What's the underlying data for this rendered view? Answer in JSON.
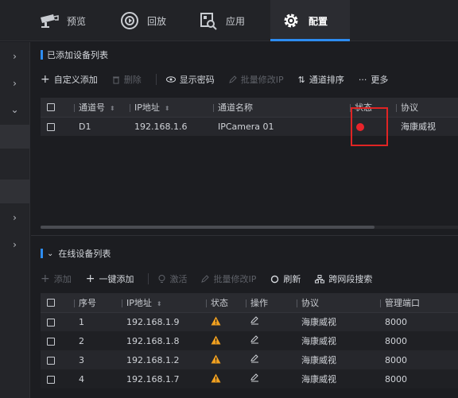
{
  "topnav": {
    "tabs": [
      {
        "label": "预览",
        "icon": "camera-icon"
      },
      {
        "label": "回放",
        "icon": "playback-icon"
      },
      {
        "label": "应用",
        "icon": "app-search-icon"
      },
      {
        "label": "配置",
        "icon": "gear-icon",
        "active": true
      }
    ]
  },
  "sidebar": {
    "items": [
      "›",
      "›",
      "⌄",
      "›",
      "›"
    ]
  },
  "added_section": {
    "title": "已添加设备列表",
    "toolbar": {
      "custom_add": "自定义添加",
      "delete": "删除",
      "show_password": "显示密码",
      "batch_ip": "批量修改IP",
      "channel_sort": "通道排序",
      "more": "更多"
    },
    "table": {
      "headers": [
        "通道号",
        "IP地址",
        "通道名称",
        "状态",
        "协议"
      ],
      "rows": [
        {
          "channel": "D1",
          "ip": "192.168.1.6",
          "name": "IPCamera 01",
          "status": "red-dot",
          "protocol": "海康威视"
        }
      ]
    }
  },
  "online_section": {
    "title": "在线设备列表",
    "toolbar": {
      "add": "添加",
      "one_click_add": "一键添加",
      "activate": "激活",
      "batch_ip": "批量修改IP",
      "refresh": "刷新",
      "cross_segment": "跨网段搜索"
    },
    "table": {
      "headers": [
        "序号",
        "IP地址",
        "状态",
        "操作",
        "协议",
        "管理端口"
      ],
      "rows": [
        {
          "no": "1",
          "ip": "192.168.1.9",
          "protocol": "海康威视",
          "port": "8000"
        },
        {
          "no": "2",
          "ip": "192.168.1.8",
          "protocol": "海康威视",
          "port": "8000"
        },
        {
          "no": "3",
          "ip": "192.168.1.2",
          "protocol": "海康威视",
          "port": "8000"
        },
        {
          "no": "4",
          "ip": "192.168.1.7",
          "protocol": "海康威视",
          "port": "8000"
        }
      ]
    }
  },
  "colors": {
    "accent": "#2d8cf0",
    "status_offline": "#e8242b",
    "warning": "#f0a020",
    "highlight_box": "#e02424"
  }
}
